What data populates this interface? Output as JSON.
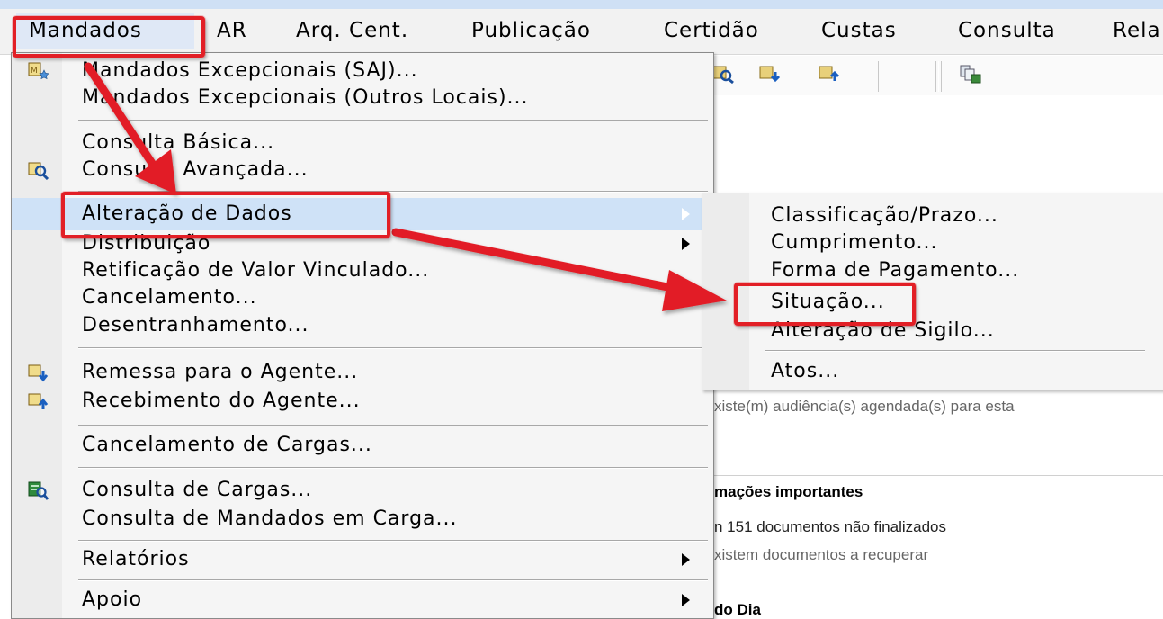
{
  "menubar": {
    "items": [
      "Mandados",
      "AR",
      "Arq. Cent.",
      "Publicação",
      "Certidão",
      "Custas",
      "Consulta",
      "Rela"
    ]
  },
  "dropdown": {
    "items": [
      {
        "label": "Mandados Excepcionais (SAJ)...",
        "icon": "mandado-star-icon"
      },
      {
        "label": "Mandados Excepcionais (Outros Locais)..."
      },
      {
        "label": "Consulta Básica..."
      },
      {
        "label": "Consulta Avançada...",
        "icon": "advanced-search-icon"
      },
      {
        "label": "Alteração de Dados",
        "submenu": true,
        "active": true
      },
      {
        "label": "Distribuição",
        "submenu": true
      },
      {
        "label": "Retificação de Valor Vinculado..."
      },
      {
        "label": "Cancelamento..."
      },
      {
        "label": "Desentranhamento..."
      },
      {
        "label": "Remessa para o Agente...",
        "icon": "send-to-agent-icon"
      },
      {
        "label": "Recebimento do Agente...",
        "icon": "receive-from-agent-icon"
      },
      {
        "label": "Cancelamento de Cargas..."
      },
      {
        "label": "Consulta de Cargas...",
        "icon": "cargo-search-icon"
      },
      {
        "label": "Consulta de Mandados em Carga..."
      },
      {
        "label": "Relatórios",
        "submenu": true
      },
      {
        "label": "Apoio",
        "submenu": true
      }
    ]
  },
  "submenu": {
    "items": [
      {
        "label": "Classificação/Prazo..."
      },
      {
        "label": "Cumprimento..."
      },
      {
        "label": "Forma de Pagamento..."
      },
      {
        "label": "Situação..."
      },
      {
        "label": "Alteração de Sigilo..."
      },
      {
        "label": "Atos..."
      }
    ]
  },
  "background": {
    "audiencia_text": "xiste(m) audiência(s) agendada(s) para esta",
    "info_title": "mações importantes",
    "docs_not_finalized": "n 151 documentos não finalizados",
    "docs_to_recover": "xistem documentos a recuperar",
    "day_title": "do Dia"
  },
  "colors": {
    "highlight": "#e21f26",
    "menu_bg": "#f5f5f5",
    "active_item": "#cfe2f7"
  }
}
